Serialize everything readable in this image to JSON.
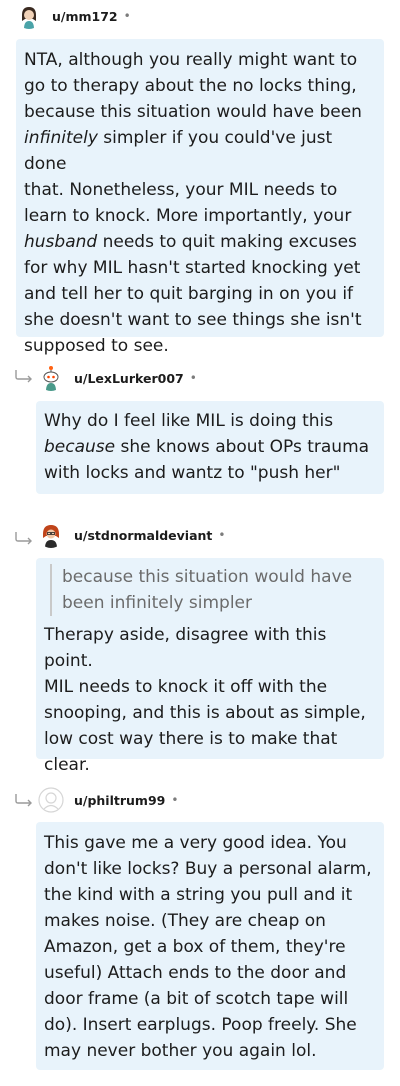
{
  "comments": [
    {
      "username": "u/mm172",
      "dot": "•",
      "body_parts": [
        "NTA, although you really might want to\ngo to therapy about the no locks thing,\nbecause this situation would have been\n",
        "infinitely",
        " simpler if you could've just done\nthat. Nonetheless, your MIL needs to\nlearn to knock. More importantly, your\n",
        "husband",
        " needs to quit making excuses\nfor why MIL hasn't started knocking yet\nand tell her to quit barging in on you if\nshe doesn't want to see things she isn't\nsupposed to see."
      ]
    },
    {
      "username": "u/LexLurker007",
      "dot": "•",
      "body_parts": [
        "Why do I feel like MIL is doing this\n",
        "because",
        " she knows about OPs trauma\nwith locks and wantz to \"push her\""
      ]
    },
    {
      "username": "u/stdnormaldeviant",
      "dot": "•",
      "quote": "because this situation would have\nbeen infinitely simpler",
      "body": "Therapy aside, disagree with this point.\nMIL needs to knock it off with the\nsnooping, and this is about as simple,\nlow cost way there is to make that\nclear."
    },
    {
      "username": "u/philtrum99",
      "dot": "•",
      "body": "This gave me a very good idea. You\ndon't like locks? Buy a personal alarm,\nthe kind with a string you pull and it\nmakes noise. (They are cheap on\nAmazon, get a box of them, they're\nuseful) Attach ends to the door and\ndoor frame (a bit of scotch tape will\ndo). Insert earplugs. Poop freely. She\nmay never bother you again lol."
    }
  ],
  "icons": {
    "reply": "reply-arrow-icon",
    "avatar_1": "avatar-girl-icon",
    "avatar_2": "avatar-snoo-icon",
    "avatar_3": "avatar-red-hair-icon",
    "avatar_4": "avatar-placeholder-icon"
  },
  "colors": {
    "bubble_bg": "#e8f3fb",
    "text": "#1c1c1c",
    "meta": "#7c7c7c",
    "quote_bar": "#c9c9c9"
  }
}
